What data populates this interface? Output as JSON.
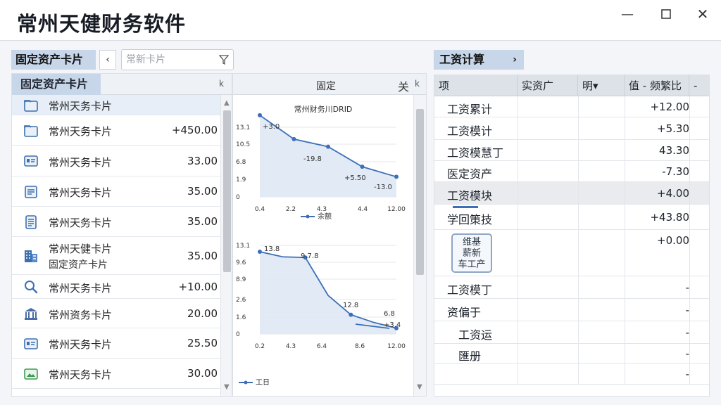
{
  "window": {
    "title": "常州天健财务软件",
    "min_glyph": "—",
    "max_glyph": "☐",
    "close_glyph": "✕"
  },
  "left_panel": {
    "tab_label": "固定资产卡片",
    "back_arrow": "‹",
    "search_placeholder": "常新卡片",
    "list_header": "固定资产卡片",
    "list_header_icon": "k",
    "items": [
      {
        "icon": "folder-icon",
        "label": "常州天务卡片",
        "label2": "",
        "value": ""
      },
      {
        "icon": "folder-icon",
        "label": "常州天务卡片",
        "label2": "",
        "value": "+450.00"
      },
      {
        "icon": "id-card-icon",
        "label": "常州天务卡片",
        "label2": "",
        "value": "33.00"
      },
      {
        "icon": "document-icon",
        "label": "常州天务卡片",
        "label2": "",
        "value": "35.00"
      },
      {
        "icon": "list-icon",
        "label": "常州天务卡片",
        "label2": "",
        "value": "35.00"
      },
      {
        "icon": "building-icon",
        "label": "常州天健卡片",
        "label2": "固定资产卡片",
        "value": "35.00"
      },
      {
        "icon": "search-icon",
        "label": "常州天务卡片",
        "label2": "",
        "value": "+10.00"
      },
      {
        "icon": "bank-icon",
        "label": "常州资务卡片",
        "label2": "",
        "value": "20.00"
      },
      {
        "icon": "id-card-icon",
        "label": "常州天务卡片",
        "label2": "",
        "value": "25.50"
      },
      {
        "icon": "image-icon",
        "label": "常州天务卡片",
        "label2": "",
        "value": "30.00"
      },
      {
        "icon": "image-icon",
        "label": "常州天务卡片",
        "label2": "",
        "value": ""
      }
    ]
  },
  "middle_panel": {
    "header_title": "固定",
    "header_close": "关",
    "header_icon": "k"
  },
  "chart_data": [
    {
      "type": "area",
      "title": "常州财务川DRID",
      "x": [
        "0.4",
        "2.2",
        "4.3",
        "4.4",
        "12.00"
      ],
      "values": [
        13.0,
        9.2,
        8.0,
        4.8,
        3.2
      ],
      "value_labels": [
        "+3.0",
        "-19.8",
        "+5.50",
        "-13.0"
      ],
      "yticks": [
        "13.1",
        "10.5",
        "6.8",
        "1.9",
        "0"
      ],
      "ylim": [
        0,
        14
      ],
      "legend": "—●— 余额"
    },
    {
      "type": "area",
      "title": "",
      "x": [
        "0.2",
        "4.3",
        "6.4",
        "8.6",
        "12.00"
      ],
      "values": [
        12.8,
        12.0,
        11.9,
        6.0,
        3.0,
        1.8,
        0.9
      ],
      "value_labels": [
        "13.8",
        "9.7.8",
        "12.8",
        "6.8",
        "+3.4"
      ],
      "yticks": [
        "13.1",
        "9.6",
        "8.9",
        "2.6",
        "1.6",
        "0"
      ],
      "ylim": [
        0,
        14
      ],
      "legend": "—●— 工日"
    }
  ],
  "right_panel": {
    "tab_label": "工资计算",
    "tab_chevron": "›",
    "columns": [
      "项",
      "实资广",
      "明▾",
      "值 - 频繁比",
      "-"
    ],
    "rows": [
      {
        "name": "工资累计",
        "value": "+12.00",
        "hl": false
      },
      {
        "name": "工资模计",
        "value": "+5.30",
        "hl": false
      },
      {
        "name": "工资模慧丁",
        "value": "43.30",
        "hl": false
      },
      {
        "name": "医定资产",
        "value": "-7.30",
        "hl": false
      },
      {
        "name": "工资模块",
        "value": "+4.00",
        "hl": true
      },
      {
        "name": "学回策技",
        "value": "+43.80",
        "hl": false
      },
      {
        "name": "",
        "value": "+0.00",
        "hl": false,
        "stamp": "维基 薪新 车工产"
      },
      {
        "name": "工资模丁",
        "value": "-",
        "hl": false
      },
      {
        "name": "资偏于",
        "value": "-",
        "hl": false
      },
      {
        "name": "工资运",
        "value": "-",
        "hl": false
      },
      {
        "name": "匯册",
        "value": "-",
        "hl": false
      },
      {
        "name": "",
        "value": "-",
        "hl": false
      }
    ]
  },
  "colors": {
    "accent": "#c8d6e9",
    "chart_line": "#3c6fb8",
    "chart_fill": "#dfe8f4"
  }
}
